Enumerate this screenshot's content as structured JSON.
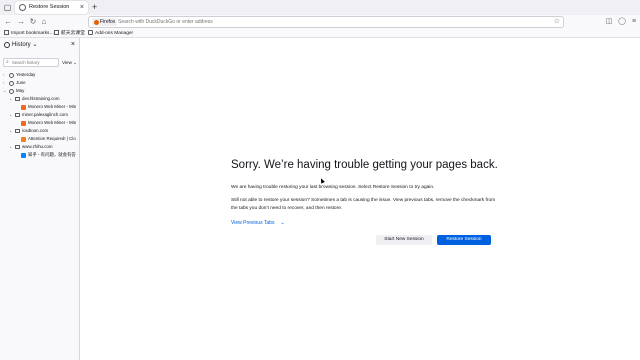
{
  "tabbar": {
    "active_tab_title": "Restore Session",
    "close_glyph": "×",
    "new_tab_glyph": "+"
  },
  "navbar": {
    "identity_label": "Firefox",
    "url_placeholder": "Search with DuckDuckGo or enter address"
  },
  "bookmarks": {
    "items": [
      {
        "label": "Import bookmarks…",
        "icon": "import-icon"
      },
      {
        "label": "航天云课堂",
        "icon": "folder-icon"
      },
      {
        "label": "Add-ons Manager",
        "icon": "puzzle-icon"
      }
    ]
  },
  "sidebar": {
    "title": "History ⌄",
    "close_glyph": "×",
    "search_placeholder": "Search history",
    "view_label": "View ⌄",
    "tree": [
      {
        "label": "Yesterday",
        "level": 0,
        "icon": "clock-icon",
        "twisty": "›"
      },
      {
        "label": "June",
        "level": 0,
        "icon": "clock-icon",
        "twisty": "›"
      },
      {
        "label": "May",
        "level": 0,
        "icon": "clock-icon",
        "twisty": "⌄"
      },
      {
        "label": "dev.hlstraining.com",
        "level": 1,
        "icon": "folder-icon",
        "twisty": "⌄"
      },
      {
        "label": "Monero Web Miner - Min",
        "level": 2,
        "icon": "monero-icon",
        "twisty": ""
      },
      {
        "label": "miner.palexaglinch.com",
        "level": 1,
        "icon": "folder-icon",
        "twisty": "⌄"
      },
      {
        "label": "Monero Web Miner - Min",
        "level": 2,
        "icon": "monero-icon",
        "twisty": ""
      },
      {
        "label": "icadtoon.com",
        "level": 1,
        "icon": "folder-icon",
        "twisty": "⌄"
      },
      {
        "label": "Attention Required! | Clo",
        "level": 2,
        "icon": "cloudflare-icon",
        "twisty": ""
      },
      {
        "label": "www.zhihu.com",
        "level": 1,
        "icon": "folder-icon",
        "twisty": "⌄"
      },
      {
        "label": "知乎 - 有问题，就会有答",
        "level": 2,
        "icon": "zhihu-icon",
        "twisty": ""
      }
    ]
  },
  "content": {
    "heading": "Sorry. We’re having trouble getting your pages back.",
    "paragraph1": "We are having trouble restoring your last browsing session. Select Restore Session to try again.",
    "paragraph2": "Still not able to restore your session? Sometimes a tab is causing the issue. View previous tabs, remove the checkmark from the tabs you don’t need to recover, and then restore.",
    "view_previous_tabs": "View Previous Tabs",
    "start_new_session": "Start New Session",
    "restore_session": "Restore Session"
  },
  "colors": {
    "accent": "#0061e0",
    "monero": "#f26822",
    "cloudflare": "#f38020",
    "zhihu": "#0084ff"
  }
}
